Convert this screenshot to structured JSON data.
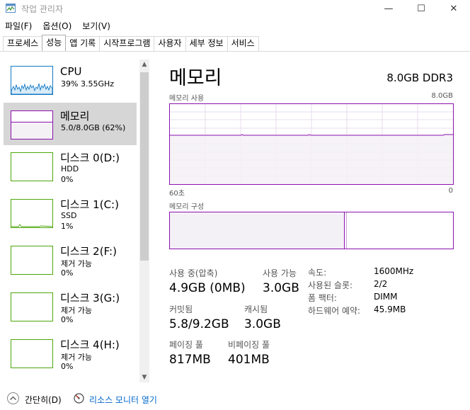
{
  "window": {
    "title": "작업 관리자",
    "minimize": "—",
    "maximize": "☐",
    "close": "✕"
  },
  "menu": [
    "파일(F)",
    "옵션(O)",
    "보기(V)"
  ],
  "tabs": [
    "프로세스",
    "성능",
    "앱 기록",
    "시작프로그램",
    "사용자",
    "세부 정보",
    "서비스"
  ],
  "active_tab": "성능",
  "sidebar": {
    "items": [
      {
        "name": "CPU",
        "sub1": "39% 3.55GHz",
        "sub2": "",
        "color": "#1178c4"
      },
      {
        "name": "메모리",
        "sub1": "5.0/8.0GB (62%)",
        "sub2": "",
        "color": "#8b12ae",
        "selected": true
      },
      {
        "name": "디스크 0(D:)",
        "sub1": "HDD",
        "sub2": "0%",
        "color": "#4da60c"
      },
      {
        "name": "디스크 1(C:)",
        "sub1": "SSD",
        "sub2": "1%",
        "color": "#4da60c"
      },
      {
        "name": "디스크 2(F:)",
        "sub1": "제거 가능",
        "sub2": "0%",
        "color": "#4da60c"
      },
      {
        "name": "디스크 3(G:)",
        "sub1": "제거 가능",
        "sub2": "0%",
        "color": "#4da60c"
      },
      {
        "name": "디스크 4(H:)",
        "sub1": "제거 가능",
        "sub2": "0%",
        "color": "#4da60c"
      }
    ],
    "scroll_up": "▲",
    "scroll_down": "▼"
  },
  "detail": {
    "title": "메모리",
    "spec": "8.0GB DDR3",
    "usage_graph_label": "메모리 사용",
    "usage_graph_max": "8.0GB",
    "time_left": "60초",
    "time_right": "0",
    "composition_label": "메모리 구성",
    "usage_fraction": 0.62,
    "stats": {
      "in_use_label": "사용 중(압축)",
      "in_use_value": "4.9GB (0MB)",
      "available_label": "사용 가능",
      "available_value": "3.0GB",
      "committed_label": "커밋됨",
      "committed_value": "5.8/9.2GB",
      "cached_label": "캐시됨",
      "cached_value": "3.0GB",
      "paged_label": "페이징 풀",
      "paged_value": "817MB",
      "nonpaged_label": "비페이징 풀",
      "nonpaged_value": "401MB"
    },
    "props": [
      {
        "key": "속도:",
        "value": "1600MHz"
      },
      {
        "key": "사용된 슬롯:",
        "value": "2/2"
      },
      {
        "key": "폼 팩터:",
        "value": "DIMM"
      },
      {
        "key": "하드웨어 예약:",
        "value": "45.9MB"
      }
    ]
  },
  "footer": {
    "fewer_details": "간단히(D)",
    "resource_monitor": "리소스 모니터 열기"
  },
  "colors": {
    "memory": "#8b12ae",
    "cpu": "#1178c4",
    "disk": "#4da60c",
    "selected_bg": "#d6d6d6"
  }
}
